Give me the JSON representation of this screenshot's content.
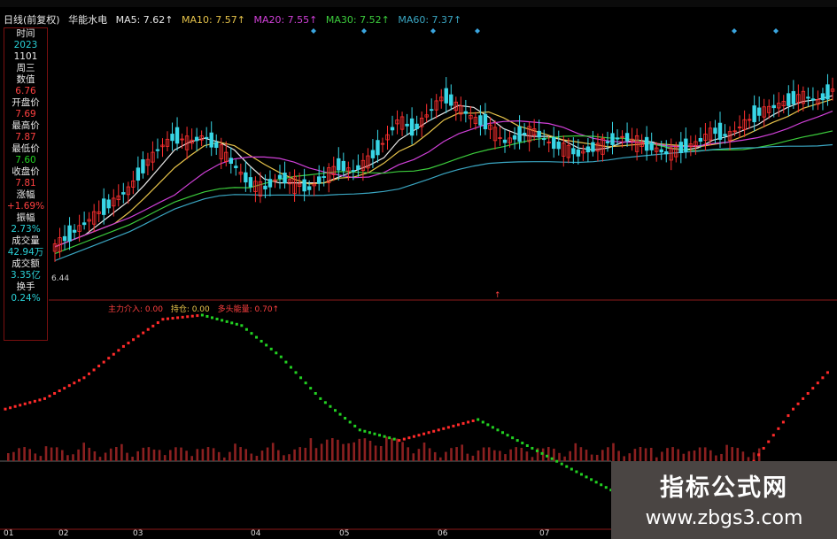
{
  "legend": {
    "period": "日线(前复权)",
    "stock": "华能水电",
    "ma5": "MA5: 7.62↑",
    "ma10": "MA10: 7.57↑",
    "ma20": "MA20: 7.55↑",
    "ma30": "MA30: 7.52↑",
    "ma60": "MA60: 7.37↑",
    "colors": {
      "ma5": "#e8e8e8",
      "ma10": "#e6c34a",
      "ma20": "#d040d8",
      "ma30": "#3ccc3c",
      "ma60": "#3aa6c2"
    }
  },
  "info_panel": [
    {
      "label": "时间",
      "value": "2023"
    },
    {
      "label": "1101",
      "value": "周三"
    },
    {
      "label": "数值",
      "value": "6.76"
    },
    {
      "label": "开盘价",
      "value": "7.69"
    },
    {
      "label": "最高价",
      "value": "7.87"
    },
    {
      "label": "最低价",
      "value": "7.60"
    },
    {
      "label": "收盘价",
      "value": "7.81"
    },
    {
      "label": "涨幅",
      "value": "+1.69%"
    },
    {
      "label": "振幅",
      "value": "2.73%"
    },
    {
      "label": "成交量",
      "value": "42.94万"
    },
    {
      "label": "成交额",
      "value": "3.35亿"
    },
    {
      "label": "换手",
      "value": "0.24%"
    }
  ],
  "low_price_label": "6.44",
  "indicator": {
    "labels": [
      "主力介入: 0.00",
      "持仓: 0.00",
      "多头能量: 0.70↑"
    ],
    "colors": {
      "rising": "#ff2a2a",
      "falling": "#22d122",
      "volume": "#8b2020"
    }
  },
  "x_axis": [
    "01",
    "02",
    "03",
    "04",
    "05",
    "06",
    "07"
  ],
  "watermark": {
    "title": "指标公式网",
    "url": "www.zbgs3.com"
  },
  "chart_data": {
    "type": "candlestick",
    "closes": [
      6.6,
      6.7,
      6.8,
      6.9,
      7.0,
      7.1,
      7.3,
      7.45,
      7.55,
      7.5,
      7.55,
      7.45,
      7.3,
      7.15,
      7.1,
      7.2,
      7.15,
      7.1,
      7.2,
      7.3,
      7.25,
      7.35,
      7.5,
      7.7,
      7.6,
      7.75,
      7.9,
      7.8,
      7.7,
      7.65,
      7.5,
      7.55,
      7.6,
      7.5,
      7.45,
      7.4,
      7.45,
      7.5,
      7.55,
      7.5,
      7.45,
      7.4,
      7.45,
      7.5,
      7.6,
      7.55,
      7.65,
      7.75,
      7.8,
      7.85,
      7.9,
      7.85,
      7.95
    ],
    "indicator_values": [
      0.55,
      0.6,
      0.7,
      0.85,
      0.98,
      1.0,
      0.95,
      0.8,
      0.6,
      0.45,
      0.4,
      0.45,
      0.5,
      0.4,
      0.3,
      0.2,
      0.1,
      0.0,
      0.05,
      0.3,
      0.55,
      0.75
    ],
    "indicator_range": [
      0,
      1
    ]
  }
}
